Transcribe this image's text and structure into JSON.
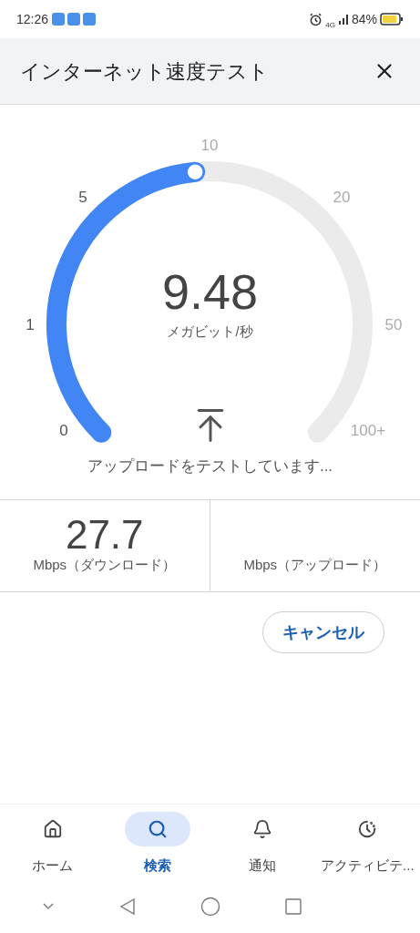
{
  "status_bar": {
    "time": "12:26",
    "network": "4G",
    "battery": "84%"
  },
  "header": {
    "title": "インターネット速度テスト"
  },
  "gauge": {
    "value": "9.48",
    "unit": "メガビット/秒",
    "status": "アップロードをテストしています...",
    "ticks": [
      {
        "label": "0",
        "passed": true
      },
      {
        "label": "1",
        "passed": true
      },
      {
        "label": "5",
        "passed": true
      },
      {
        "label": "10",
        "passed": false
      },
      {
        "label": "20",
        "passed": false
      },
      {
        "label": "50",
        "passed": false
      },
      {
        "label": "100+",
        "passed": false
      }
    ]
  },
  "results": [
    {
      "value": "27.7",
      "label": "Mbps（ダウンロード）"
    },
    {
      "label": "Mbps（アップロード）"
    }
  ],
  "cancel_button": "キャンセル",
  "bottom_nav": [
    {
      "label": "ホーム",
      "kind": "home",
      "selected": false
    },
    {
      "label": "検索",
      "kind": "search",
      "selected": true
    },
    {
      "label": "通知",
      "kind": "bell",
      "selected": false
    },
    {
      "label": "アクティビテ...",
      "kind": "activity",
      "selected": false
    }
  ]
}
